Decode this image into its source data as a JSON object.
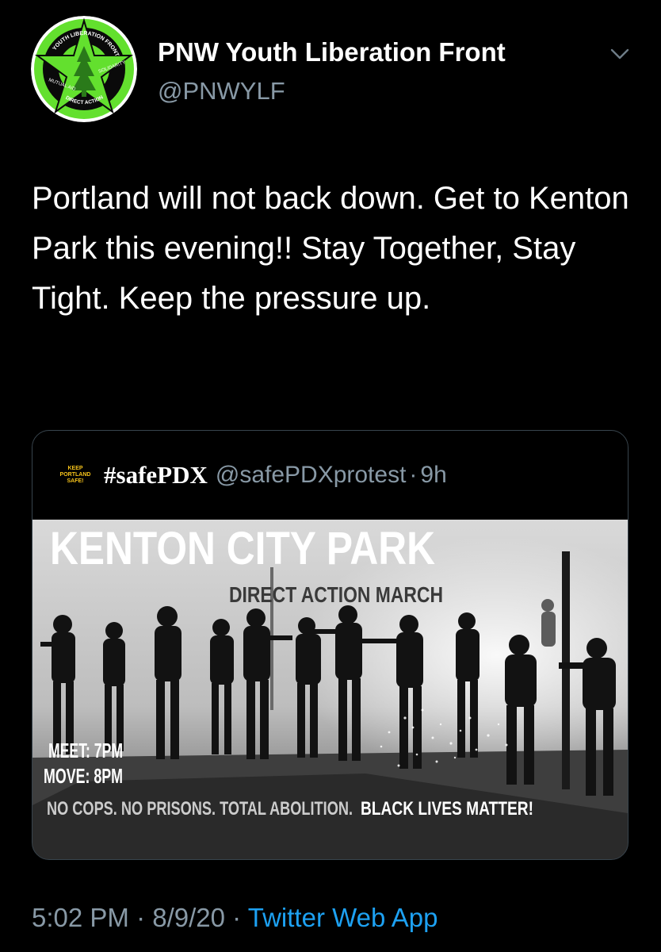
{
  "author": {
    "name": "PNW Youth Liberation Front",
    "handle": "@PNWYLF",
    "avatar_text": [
      "YOUTH LIBERATION FRONT",
      "MUTUAL AID",
      "SOLIDARITY",
      "DIRECT ACTION"
    ],
    "avatar_colors": {
      "ring": "#63e02e",
      "star": "#63e02e",
      "tree": "#2a7a1a"
    }
  },
  "tweet": {
    "text": "Portland will not back down. Get to Kenton Park this evening!! Stay Together, Stay Tight. Keep the pressure up."
  },
  "quoted": {
    "avatar_lines": [
      "KEEP",
      "PORTLAND",
      "SAFE!"
    ],
    "name": "#safePDX",
    "handle": "@safePDXprotest",
    "separator": "·",
    "time": "9h",
    "poster": {
      "title": "KENTON CITY PARK",
      "subtitle": "DIRECT ACTION MARCH",
      "meet": "MEET: 7PM",
      "move": "MOVE: 8PM",
      "slogan": "NO COPS. NO PRISONS. TOTAL ABOLITION.",
      "slogan_emphasis": "BLACK LIVES MATTER!"
    }
  },
  "footer": {
    "time": "5:02 PM",
    "sep1": "·",
    "date": "8/9/20",
    "sep2": "·",
    "app": "Twitter Web App"
  },
  "icons": {
    "caret": "chevron-down-icon"
  },
  "colors": {
    "background": "#000000",
    "secondary_text": "#8899a6",
    "link": "#1da1f2",
    "border": "#38444d"
  }
}
